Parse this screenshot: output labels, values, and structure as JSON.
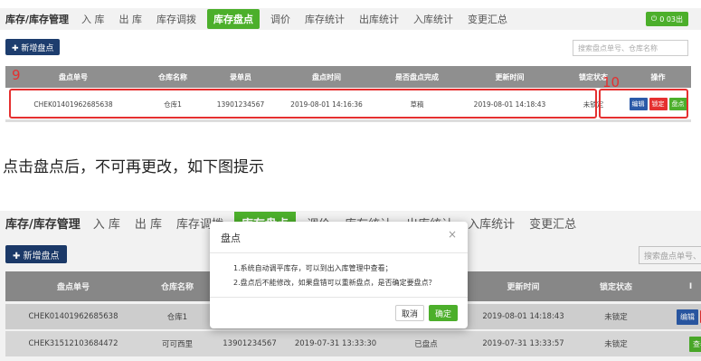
{
  "colors": {
    "active_tab": "#4caf2b",
    "primary_button": "#1d3d6e",
    "table_header": "#8f8f8f",
    "edit_button": "#2b5aa8",
    "lock_button": "#e53030",
    "count_button": "#4caf2b",
    "annotation": "#e53030"
  },
  "panel1": {
    "nav": {
      "title": "库存/库存管理",
      "items": [
        "入 库",
        "出 库",
        "库存调拨",
        "库存盘点",
        "调价",
        "库存统计",
        "出库统计",
        "入库统计",
        "变更汇总"
      ],
      "active_index": 3
    },
    "exit_button": {
      "icon": "power-icon",
      "label": "0 03出"
    },
    "new_button": "✚ 新增盘点",
    "search_placeholder": "搜索盘点单号、仓库名称",
    "table_headers": [
      "盘点单号",
      "仓库名称",
      "录单员",
      "盘点时间",
      "是否盘点完成",
      "更新时间",
      "锁定状态",
      "操作"
    ],
    "row": {
      "cells": [
        "CHEK01401962685638",
        "仓库1",
        "13901234567",
        "2019-08-01 14:16:36",
        "草稿",
        "2019-08-01 14:18:43",
        "未锁定"
      ],
      "actions": [
        "编辑",
        "锁定",
        "盘点"
      ]
    },
    "annotation_left": "9",
    "annotation_right": "10"
  },
  "caption": "点击盘点后，不可再更改，如下图提示",
  "panel2": {
    "nav": {
      "title": "库存/库存管理",
      "items": [
        "入 库",
        "出 库",
        "库存调拨",
        "库存盘点",
        "调价",
        "库存统计",
        "出库统计",
        "入库统计",
        "变更汇总"
      ],
      "active_index": 3
    },
    "new_button": "✚ 新增盘点",
    "search_placeholder": "搜索盘点单号、",
    "table_headers": [
      "盘点单号",
      "仓库名称",
      "",
      "",
      "",
      "更新时间",
      "锁定状态",
      "Ⅰ"
    ],
    "rows": [
      {
        "cells": [
          "CHEK01401962685638",
          "仓库1",
          "1",
          "",
          "",
          "2019-08-01 14:18:43",
          "未锁定"
        ],
        "actions": [
          "编辑",
          ""
        ]
      },
      {
        "cells": [
          "CHEK31512103684472",
          "可可西里",
          "13901234567",
          "2019-07-31 13:33:30",
          "已盘点",
          "2019-07-31 13:33:57",
          "未锁定"
        ],
        "actions": [
          "查看"
        ]
      }
    ],
    "dialog": {
      "title": "盘点",
      "close": "×",
      "lines": [
        "1.系统自动调平库存，可以到出入库管理中查看；",
        "2.盘点后不能修改，如果盘错可以重新盘点，是否确定要盘点？"
      ],
      "cancel": "取消",
      "ok": "确定"
    }
  }
}
